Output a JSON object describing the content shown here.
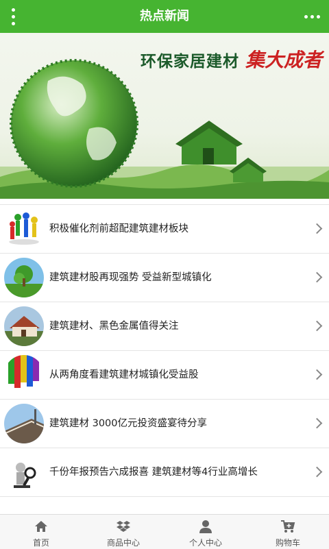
{
  "header": {
    "title": "热点新闻",
    "menu_icon": "vertical-dots-icon",
    "more_icon": "horizontal-dots-icon",
    "bg_color": "#46b431"
  },
  "banner": {
    "title": "环保家居建材",
    "slogan": "集大成者",
    "slide_count": 2,
    "active_slide": 1
  },
  "news": [
    {
      "title": "积极催化剂前超配建筑建材板块",
      "thumb_icon": "people-figures-image"
    },
    {
      "title": "建筑建材股再现强势 受益新型城镇化",
      "thumb_icon": "green-tree-image"
    },
    {
      "title": "建筑建材、黑色金属值得关注",
      "thumb_icon": "house-image"
    },
    {
      "title": "从两角度看建筑建材城镇化受益股",
      "thumb_icon": "paint-colors-image"
    },
    {
      "title": "建筑建材 3000亿元投资盛宴待分享",
      "thumb_icon": "building-sky-image"
    },
    {
      "title": "千份年报预告六成报喜 建筑建材等4行业高增长",
      "thumb_icon": "magnifier-figure-image"
    }
  ],
  "footer": {
    "tabs": [
      {
        "label": "首页",
        "icon": "home-icon"
      },
      {
        "label": "商品中心",
        "icon": "dropbox-icon"
      },
      {
        "label": "个人中心",
        "icon": "user-icon"
      },
      {
        "label": "购物车",
        "icon": "cart-icon"
      }
    ]
  }
}
